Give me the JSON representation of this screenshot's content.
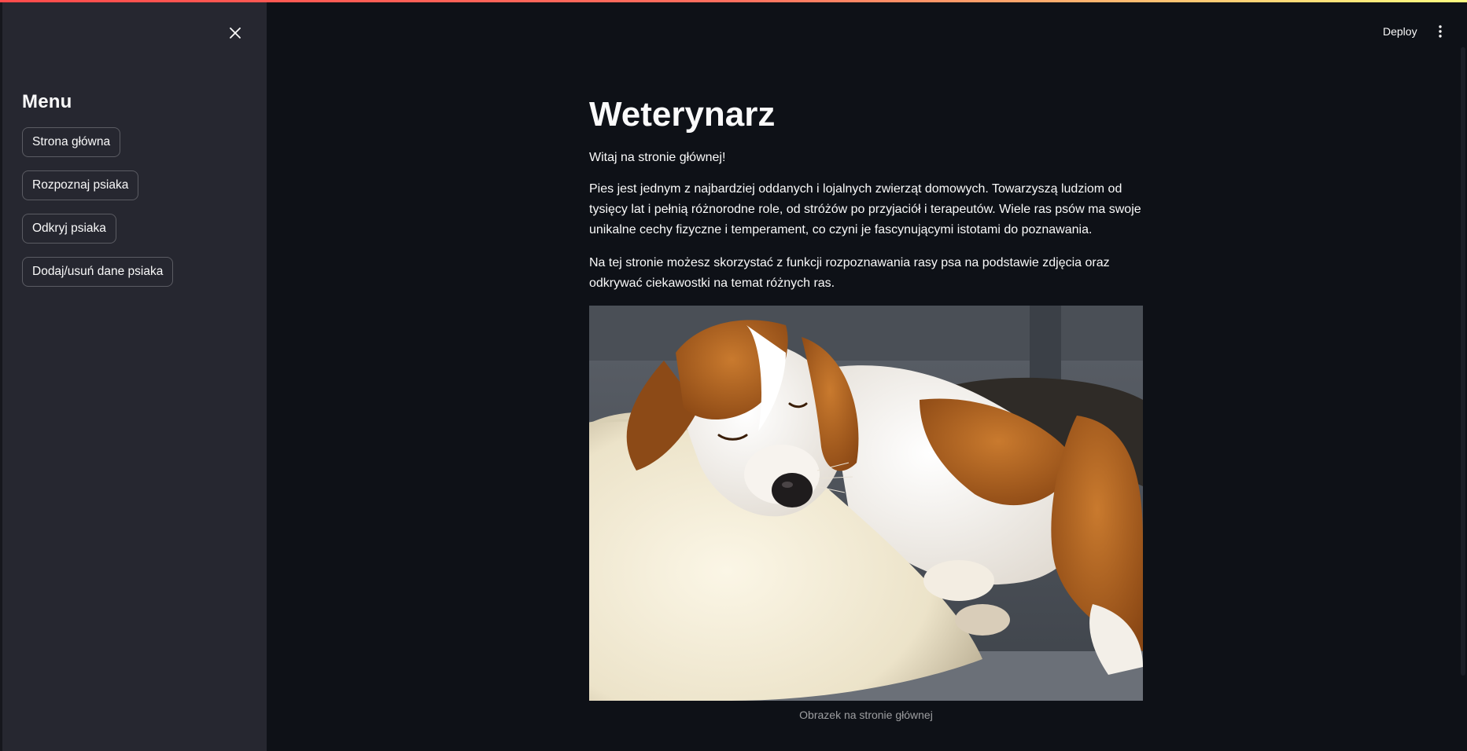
{
  "sidebar": {
    "close_icon": "close-icon",
    "title": "Menu",
    "buttons": [
      {
        "label": "Strona główna"
      },
      {
        "label": "Rozpoznaj psiaka"
      },
      {
        "label": "Odkryj psiaka"
      },
      {
        "label": "Dodaj/usuń dane psiaka"
      }
    ]
  },
  "header": {
    "deploy_label": "Deploy",
    "menu_icon": "kebab-menu-icon"
  },
  "main": {
    "title": "Weterynarz",
    "welcome": "Witaj na stronie głównej!",
    "paragraph_1": "Pies jest jednym z najbardziej oddanych i lojalnych zwierząt domowych. Towarzyszą ludziom od tysięcy lat i pełnią różnorodne role, od stróżów po przyjaciół i terapeutów. Wiele ras psów ma swoje unikalne cechy fizyczne i temperament, co czyni je fascynującymi istotami do poznawania.",
    "paragraph_2": "Na tej stronie możesz skorzystać z funkcji rozpoznawania rasy psa na podstawie zdjęcia oraz odkrywać ciekawostki na temat różnych ras.",
    "image_caption": "Obrazek na stronie głównej"
  },
  "colors": {
    "app_background": "#0e1117",
    "sidebar_background": "#262730",
    "text": "#fafafa",
    "accent_gradient_start": "#ff4b4b",
    "accent_gradient_end": "#fffd80"
  }
}
